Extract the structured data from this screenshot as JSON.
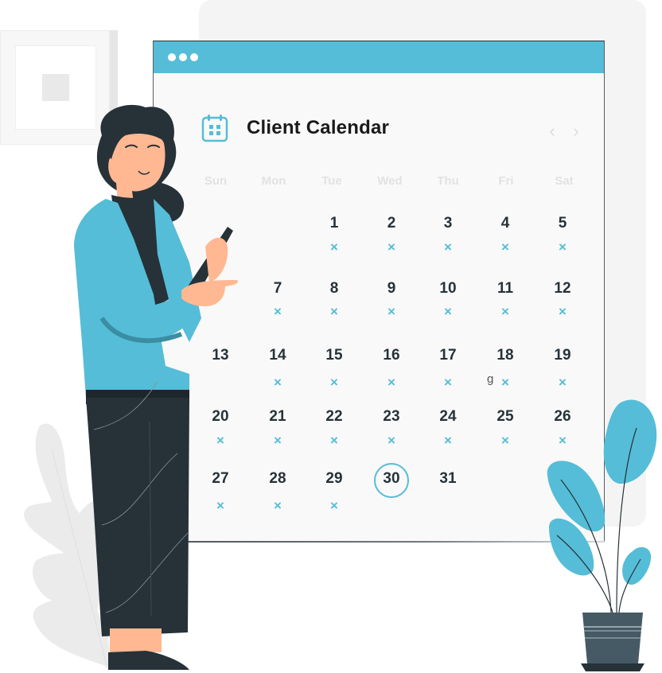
{
  "calendar": {
    "title": "Client Calendar",
    "icon": "calendar-icon",
    "nav": {
      "prev": "‹",
      "next": "›"
    },
    "weekdays": [
      "Sun",
      "Mon",
      "Tue",
      "Wed",
      "Thu",
      "Fri",
      "Sat"
    ],
    "mark_glyph": "×",
    "today": "30",
    "stray_text": "g",
    "days": [
      {
        "label": "1",
        "col": 2,
        "row": 0,
        "marked": true
      },
      {
        "label": "2",
        "col": 3,
        "row": 0,
        "marked": true
      },
      {
        "label": "3",
        "col": 4,
        "row": 0,
        "marked": true
      },
      {
        "label": "4",
        "col": 5,
        "row": 0,
        "marked": true
      },
      {
        "label": "5",
        "col": 6,
        "row": 0,
        "marked": true
      },
      {
        "label": "7",
        "col": 1,
        "row": 1,
        "marked": true
      },
      {
        "label": "8",
        "col": 2,
        "row": 1,
        "marked": true
      },
      {
        "label": "9",
        "col": 3,
        "row": 1,
        "marked": true
      },
      {
        "label": "10",
        "col": 4,
        "row": 1,
        "marked": true
      },
      {
        "label": "11",
        "col": 5,
        "row": 1,
        "marked": true
      },
      {
        "label": "12",
        "col": 6,
        "row": 1,
        "marked": true
      },
      {
        "label": "13",
        "col": 0,
        "row": 2,
        "marked": false
      },
      {
        "label": "14",
        "col": 1,
        "row": 2,
        "marked": true
      },
      {
        "label": "15",
        "col": 2,
        "row": 2,
        "marked": true
      },
      {
        "label": "16",
        "col": 3,
        "row": 2,
        "marked": true
      },
      {
        "label": "17",
        "col": 4,
        "row": 2,
        "marked": true
      },
      {
        "label": "18",
        "col": 5,
        "row": 2,
        "marked": true
      },
      {
        "label": "19",
        "col": 6,
        "row": 2,
        "marked": true
      },
      {
        "label": "20",
        "col": 0,
        "row": 3,
        "marked": true
      },
      {
        "label": "21",
        "col": 1,
        "row": 3,
        "marked": true
      },
      {
        "label": "22",
        "col": 2,
        "row": 3,
        "marked": true
      },
      {
        "label": "23",
        "col": 3,
        "row": 3,
        "marked": true
      },
      {
        "label": "24",
        "col": 4,
        "row": 3,
        "marked": true
      },
      {
        "label": "25",
        "col": 5,
        "row": 3,
        "marked": true
      },
      {
        "label": "26",
        "col": 6,
        "row": 3,
        "marked": true
      },
      {
        "label": "27",
        "col": 0,
        "row": 4,
        "marked": true
      },
      {
        "label": "28",
        "col": 1,
        "row": 4,
        "marked": true
      },
      {
        "label": "29",
        "col": 2,
        "row": 4,
        "marked": true
      },
      {
        "label": "30",
        "col": 3,
        "row": 4,
        "marked": false
      },
      {
        "label": "31",
        "col": 4,
        "row": 4,
        "marked": false
      }
    ]
  },
  "colors": {
    "accent": "#55bdd7",
    "text_dark": "#263238",
    "weekday_text": "#e2e2e2",
    "window_bg": "#f9f9f9",
    "panel_bg": "#f4f4f4",
    "pot": "#455a64"
  },
  "illustration": {
    "figure": "woman-holding-tablet-pointing",
    "plant": "potted-plant",
    "wall_frame": "picture-frame",
    "background_leaf": "leaf"
  }
}
